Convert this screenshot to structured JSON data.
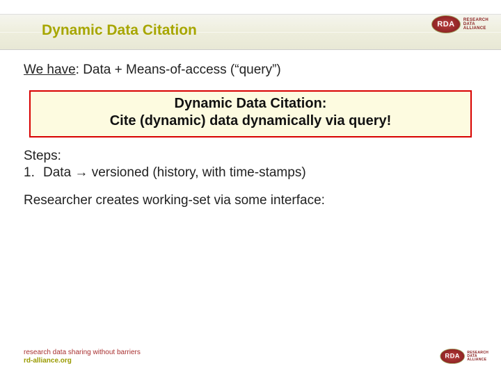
{
  "title": "Dynamic Data Citation",
  "logo": {
    "abbr": "RDA",
    "line1": "RESEARCH",
    "line2": "DATA",
    "line3": "ALLIANCE"
  },
  "we_have": {
    "prefix": "We have",
    "rest": ": Data + Means-of-access (“query”)"
  },
  "callout": {
    "line1": "Dynamic Data Citation:",
    "line2": "Cite (dynamic) data dynamically via query!"
  },
  "steps": {
    "heading": "Steps:",
    "items": [
      {
        "num": "1.",
        "text": "Data → versioned (history, with time-stamps)"
      }
    ]
  },
  "researcher_line": "Researcher creates working-set via some interface:",
  "footer": {
    "tagline": "research data sharing without barriers",
    "url": "rd-alliance.org"
  }
}
